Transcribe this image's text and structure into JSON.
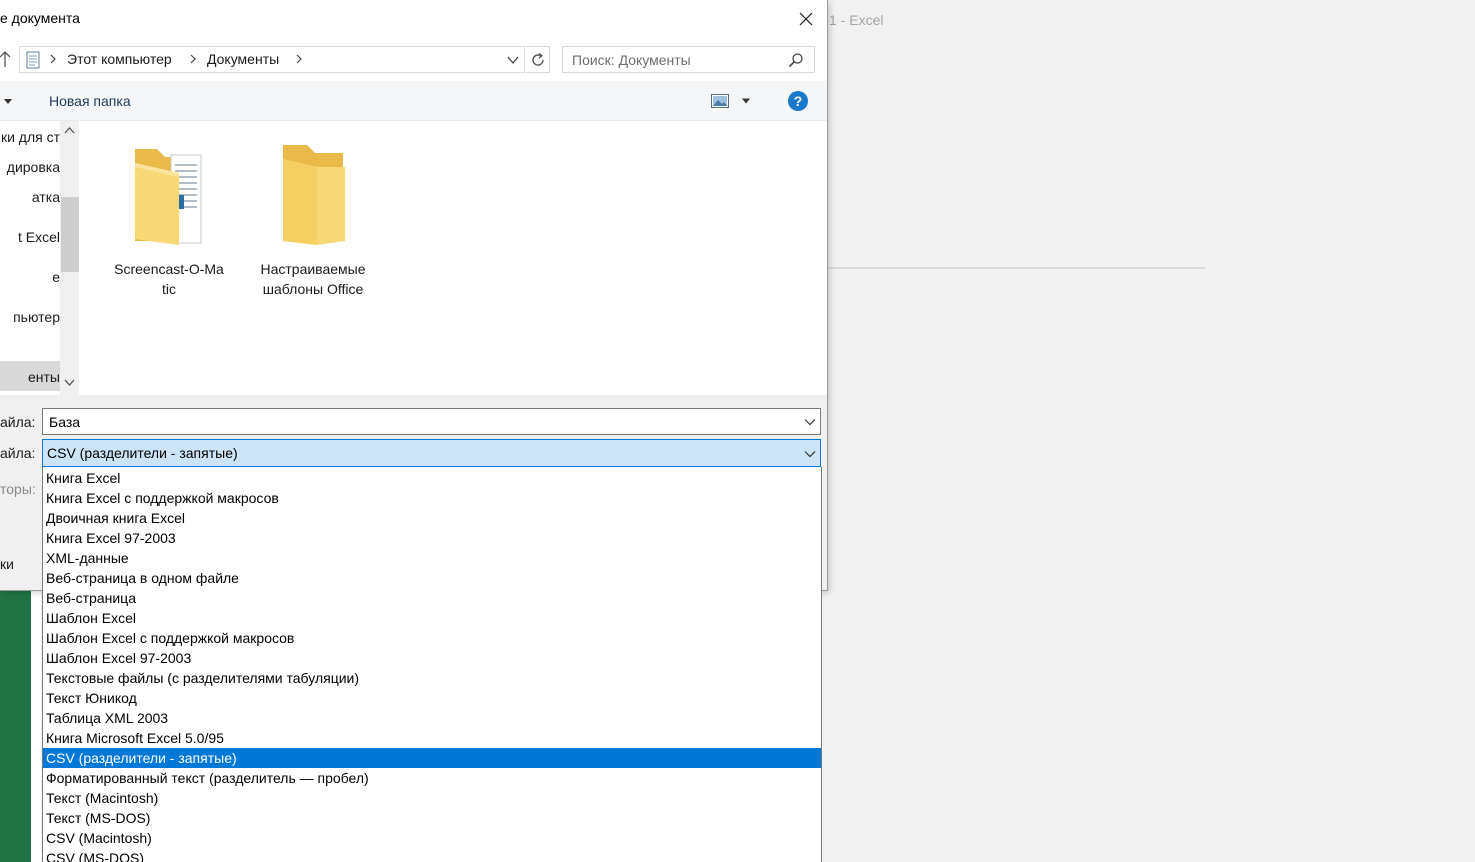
{
  "background_app": {
    "title": "1 - Excel"
  },
  "dialog": {
    "title": "е документа",
    "address": {
      "crumbs": [
        "Этот компьютер",
        "Документы"
      ]
    },
    "search": {
      "placeholder": "Поиск: Документы"
    },
    "toolbar": {
      "new_folder_label": "Новая папка"
    },
    "nav_items": [
      "ки для ст",
      "дировка",
      "атка",
      "t Excel",
      "е",
      "пьютер",
      "енты"
    ],
    "folders": [
      {
        "name_line1": "Screencast-O-Ma",
        "name_line2": "tic",
        "icon": "folder-with-documents-icon"
      },
      {
        "name_line1": "Настраиваемые",
        "name_line2": "шаблоны Office",
        "icon": "folder-icon"
      }
    ],
    "filename_label": "айла:",
    "filename_value": "База",
    "filetype_label": "айла:",
    "filetype_value": "CSV (разделители - запятые)",
    "authors_label": "торы:",
    "tags_label": "ки"
  },
  "filetype_options": [
    "Книга Excel",
    "Книга Excel с поддержкой макросов",
    "Двоичная книга Excel",
    "Книга Excel 97-2003",
    "XML-данные",
    "Веб-страница в одном файле",
    "Веб-страница",
    "Шаблон Excel",
    "Шаблон Excel с поддержкой макросов",
    "Шаблон Excel 97-2003",
    "Текстовые файлы (с разделителями табуляции)",
    "Текст Юникод",
    "Таблица XML 2003",
    "Книга Microsoft Excel 5.0/95",
    "CSV (разделители - запятые)",
    "Форматированный текст (разделитель — пробел)",
    "Текст (Macintosh)",
    "Текст (MS-DOS)",
    "CSV (Macintosh)",
    "CSV (MS-DOS)"
  ],
  "selected_option_index": 14,
  "colors": {
    "accent": "#0078d7",
    "selection_light": "#cce4f7",
    "excel_green": "#217346",
    "folder_yellow": "#f8d775"
  }
}
